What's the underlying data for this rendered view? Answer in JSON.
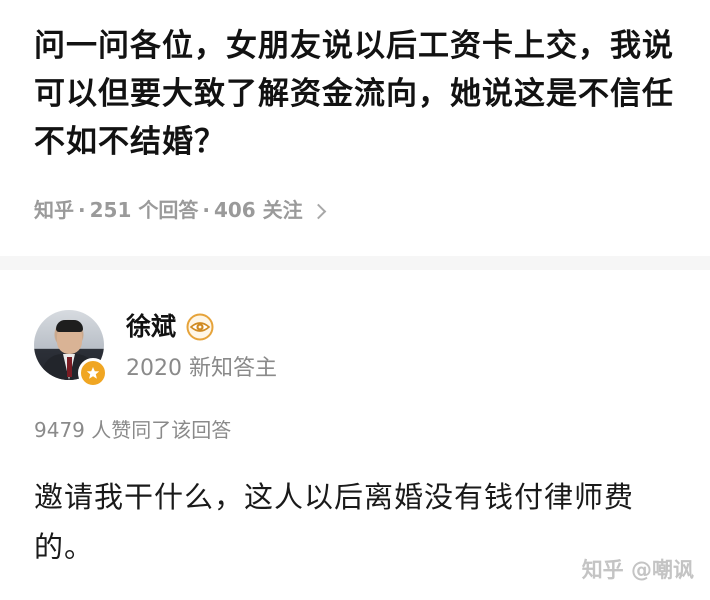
{
  "question": {
    "title": "问一问各位，女朋友说以后工资卡上交，我说可以但要大致了解资金流向，她说这是不信任不如不结婚？",
    "meta": {
      "source": "知乎",
      "answers": "251 个回答",
      "followers": "406 关注"
    }
  },
  "answer": {
    "author": {
      "name": "徐斌",
      "description": "2020 新知答主"
    },
    "votes": "9479 人赞同了该回答",
    "body": "邀请我干什么，这人以后离婚没有钱付律师费的。"
  },
  "watermark": "知乎 @嘲讽",
  "colors": {
    "badge": "#f0a623",
    "eye_ring": "#e6a33a",
    "meta_text": "#9a9a9a"
  },
  "icons": {
    "eye": "eye-icon",
    "badge": "star-badge-icon",
    "chevron": "chevron-right-icon"
  }
}
